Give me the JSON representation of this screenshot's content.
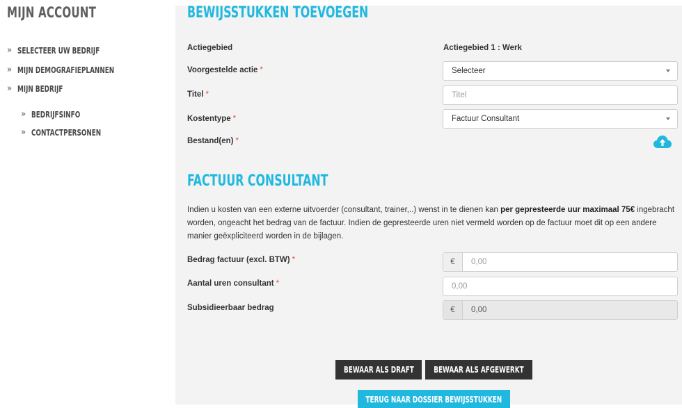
{
  "sidebar": {
    "title": "Mijn Account",
    "items": [
      {
        "label": "Selecteer uw bedrijf"
      },
      {
        "label": "Mijn demografieplannen"
      },
      {
        "label": "Mijn bedrijf"
      }
    ],
    "subitems": [
      {
        "label": "Bedrijfsinfo"
      },
      {
        "label": "Contactpersonen"
      }
    ],
    "chevron": "»"
  },
  "form": {
    "title": "Bewijsstukken toevoegen",
    "actiegebied_label": "Actiegebied",
    "actiegebied_value": "Actiegebied 1 : Werk",
    "voorgestelde_actie_label": "Voorgestelde actie",
    "voorgestelde_actie_value": "Selecteer",
    "titel_label": "Titel",
    "titel_placeholder": "Titel",
    "kostentype_label": "Kostentype",
    "kostentype_value": "Factuur Consultant",
    "bestanden_label": "Bestand(en)",
    "required_mark": "*",
    "upload_icon": "cloud-upload-icon"
  },
  "factuur": {
    "title": "Factuur consultant",
    "text_part1": "Indien u kosten van een externe uitvoerder (consultant, trainer,..) wenst in te dienen kan ",
    "text_bold": "per gepresteerde uur maximaal 75€",
    "text_part2": " ingebracht worden, ongeacht het bedrag van de factuur. Indien de gepresteerde uren niet vermeld worden op de factuur moet dit op een andere manier geëxpliciteerd worden in de bijlagen.",
    "bedrag_label": "Bedrag factuur (excl. BTW)",
    "bedrag_currency": "€",
    "bedrag_placeholder": "0,00",
    "uren_label": "Aantal uren consultant",
    "uren_placeholder": "0,00",
    "subsidie_label": "Subsidieerbaar bedrag",
    "subsidie_currency": "€",
    "subsidie_value": "0,00"
  },
  "buttons": {
    "draft": "Bewaar als draft",
    "afgewerkt": "Bewaar als afgewerkt",
    "terug": "Terug naar dossier bewijsstukken"
  },
  "colors": {
    "accent": "#21b8e0",
    "dark_button": "#333333",
    "required": "#e74c3c",
    "main_bg": "#f3f3f3"
  }
}
